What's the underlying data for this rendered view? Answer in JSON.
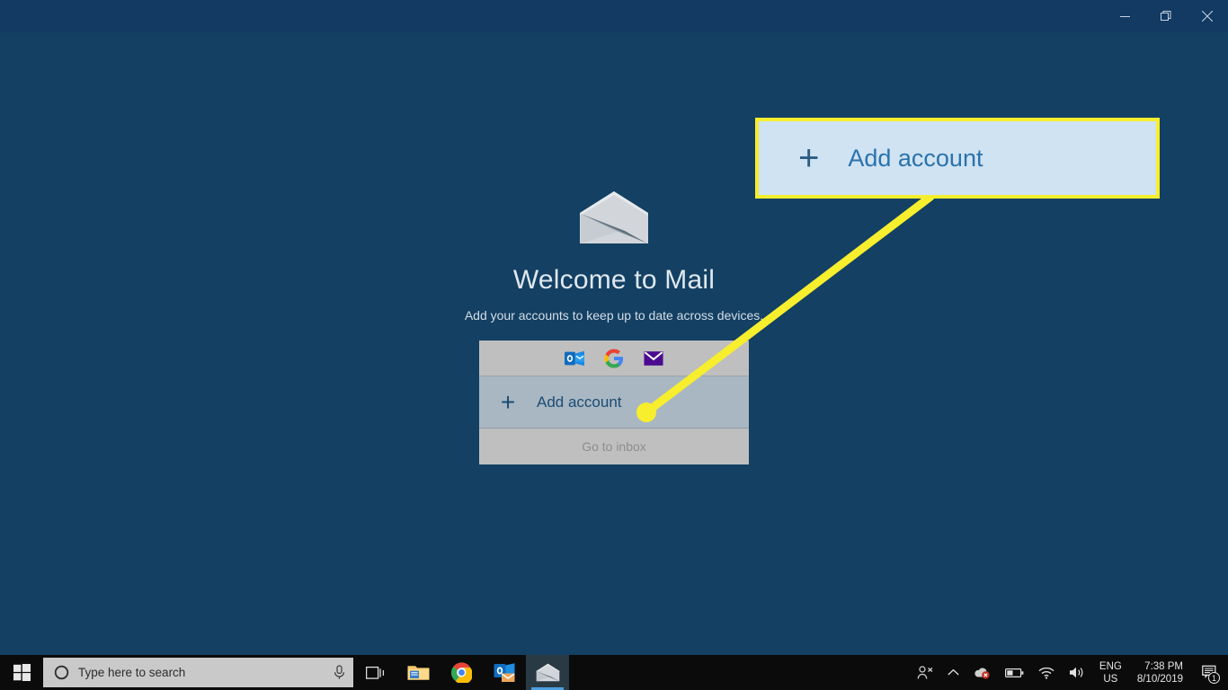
{
  "window": {
    "controls": [
      {
        "name": "minimize",
        "glyph": "minimize-icon"
      },
      {
        "name": "restore",
        "glyph": "restore-icon"
      },
      {
        "name": "close",
        "glyph": "close-icon"
      }
    ]
  },
  "mail": {
    "logo_icon": "mail-envelope-icon",
    "title": "Welcome to Mail",
    "subtitle": "Add your accounts to keep up to date across devices.",
    "providers": [
      {
        "name": "outlook",
        "icon": "outlook-icon"
      },
      {
        "name": "google",
        "icon": "google-icon"
      },
      {
        "name": "yahoo",
        "icon": "yahoo-mail-icon"
      }
    ],
    "add_account_label": "Add account",
    "add_account_plus": "+",
    "go_to_inbox_label": "Go to inbox"
  },
  "annotation": {
    "callout_label": "Add account",
    "callout_plus": "+",
    "border_color": "#f7ee2e",
    "fill_color": "#cfe3f3",
    "text_color": "#2c72ab"
  },
  "taskbar": {
    "start_icon": "windows-start-icon",
    "search": {
      "icon": "cortana-circle-icon",
      "placeholder": "Type here to search",
      "mic_icon": "microphone-icon"
    },
    "pinned": [
      {
        "name": "task-view",
        "icon": "task-view-icon",
        "active": false
      },
      {
        "name": "file-explorer",
        "icon": "file-explorer-icon",
        "active": false
      },
      {
        "name": "chrome",
        "icon": "google-chrome-icon",
        "active": false
      },
      {
        "name": "outlook",
        "icon": "outlook-app-icon",
        "active": false
      },
      {
        "name": "mail",
        "icon": "mail-app-icon",
        "active": true
      }
    ],
    "tray": {
      "people_icon": "people-icon",
      "chevron_icon": "chevron-up-icon",
      "onedrive_icon": "onedrive-error-icon",
      "battery_icon": "battery-icon",
      "wifi_icon": "wifi-icon",
      "volume_icon": "speaker-icon",
      "language_line1": "ENG",
      "language_line2": "US",
      "time": "7:38 PM",
      "date": "8/10/2019",
      "action_center_icon": "action-center-icon",
      "notification_count": "1"
    }
  }
}
